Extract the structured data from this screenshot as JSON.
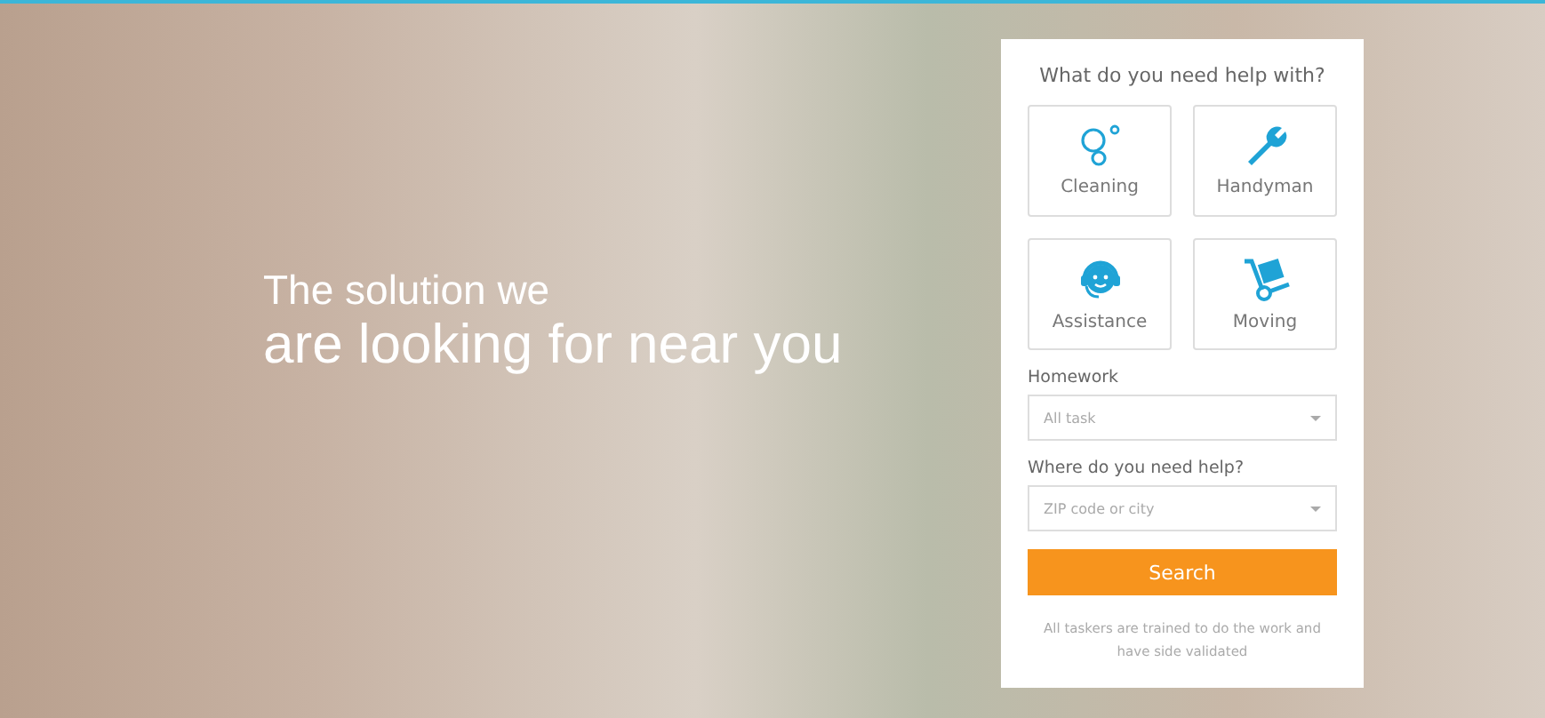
{
  "headline": {
    "line_1": "The solution we",
    "line_2": "are looking for near you"
  },
  "panel": {
    "title": "What do you need help with?",
    "services": [
      {
        "label": "Cleaning",
        "kind": "bubbles"
      },
      {
        "label": "Handyman",
        "kind": "wrench"
      },
      {
        "label": "Assistance",
        "kind": "headset"
      },
      {
        "label": "Moving",
        "kind": "trolley"
      }
    ],
    "fields": [
      {
        "label": "Homework",
        "placeholder": "All task"
      },
      {
        "label": "Where do you need help?",
        "placeholder": "ZIP code or city"
      }
    ],
    "button": "Search",
    "note": "All taskers are trained to do the work and have side validated"
  }
}
